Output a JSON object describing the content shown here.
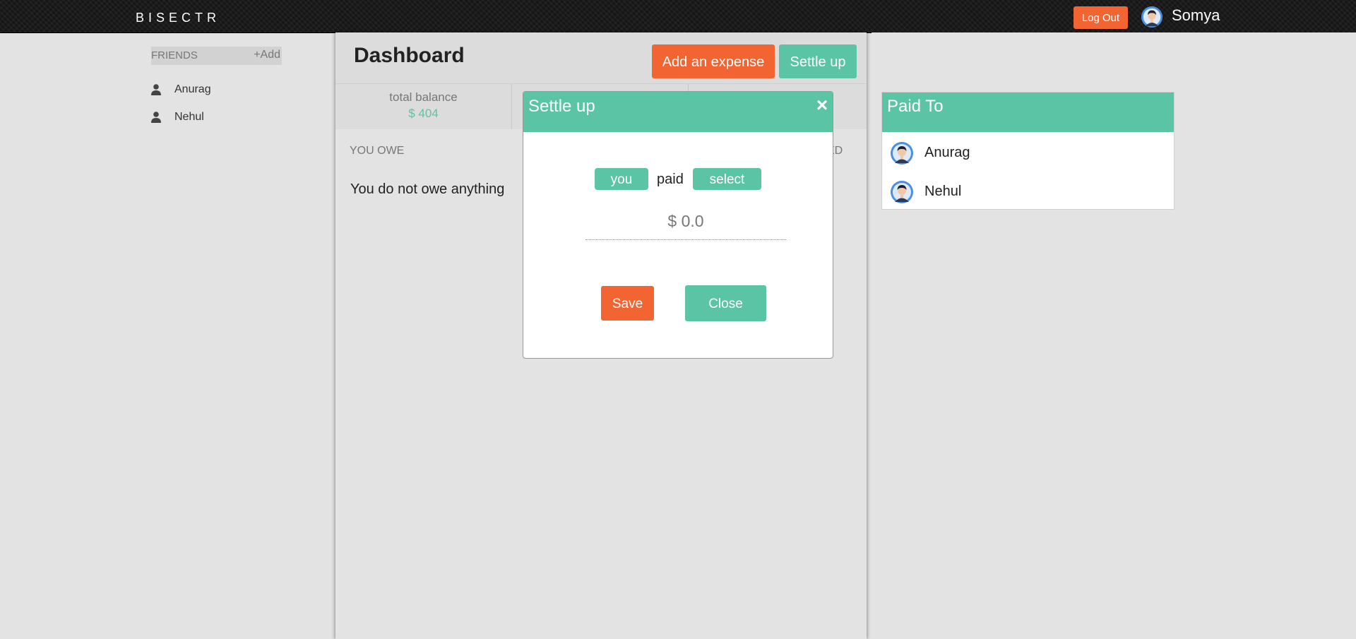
{
  "app": {
    "brand": "BISECTR"
  },
  "topbar": {
    "logout_label": "Log Out",
    "user_name": "Somya"
  },
  "sidebar": {
    "header": "FRIENDS",
    "add_label": "+Add",
    "friends": [
      {
        "label": "Anurag",
        "icon": "person-icon"
      },
      {
        "label": "Nehul",
        "icon": "person-icon"
      }
    ]
  },
  "dashboard": {
    "title": "Dashboard",
    "add_expense_label": "Add an expense",
    "settle_up_label": "Settle up",
    "balance": {
      "total_label": "total balance",
      "total_value": "$ 404"
    },
    "you_owe_header": "YOU OWE",
    "you_owe_text": "You do not owe anything",
    "owed_header_partial": "ED"
  },
  "settle_modal": {
    "title": "Settle up",
    "close_icon": "×",
    "payer": "you",
    "verb": "paid",
    "payee": "select",
    "amount_placeholder": "$ 0.0",
    "amount_value": "",
    "save_label": "Save",
    "close_label": "Close"
  },
  "paid_to": {
    "title": "Paid To",
    "items": [
      {
        "label": "Anurag",
        "icon": "avatar-icon"
      },
      {
        "label": "Nehul",
        "icon": "avatar-icon"
      }
    ]
  },
  "colors": {
    "accent_green": "#5bc4a5",
    "accent_orange": "#f26533",
    "topbar_bg": "#161616",
    "page_bg": "#e3e3e3"
  }
}
